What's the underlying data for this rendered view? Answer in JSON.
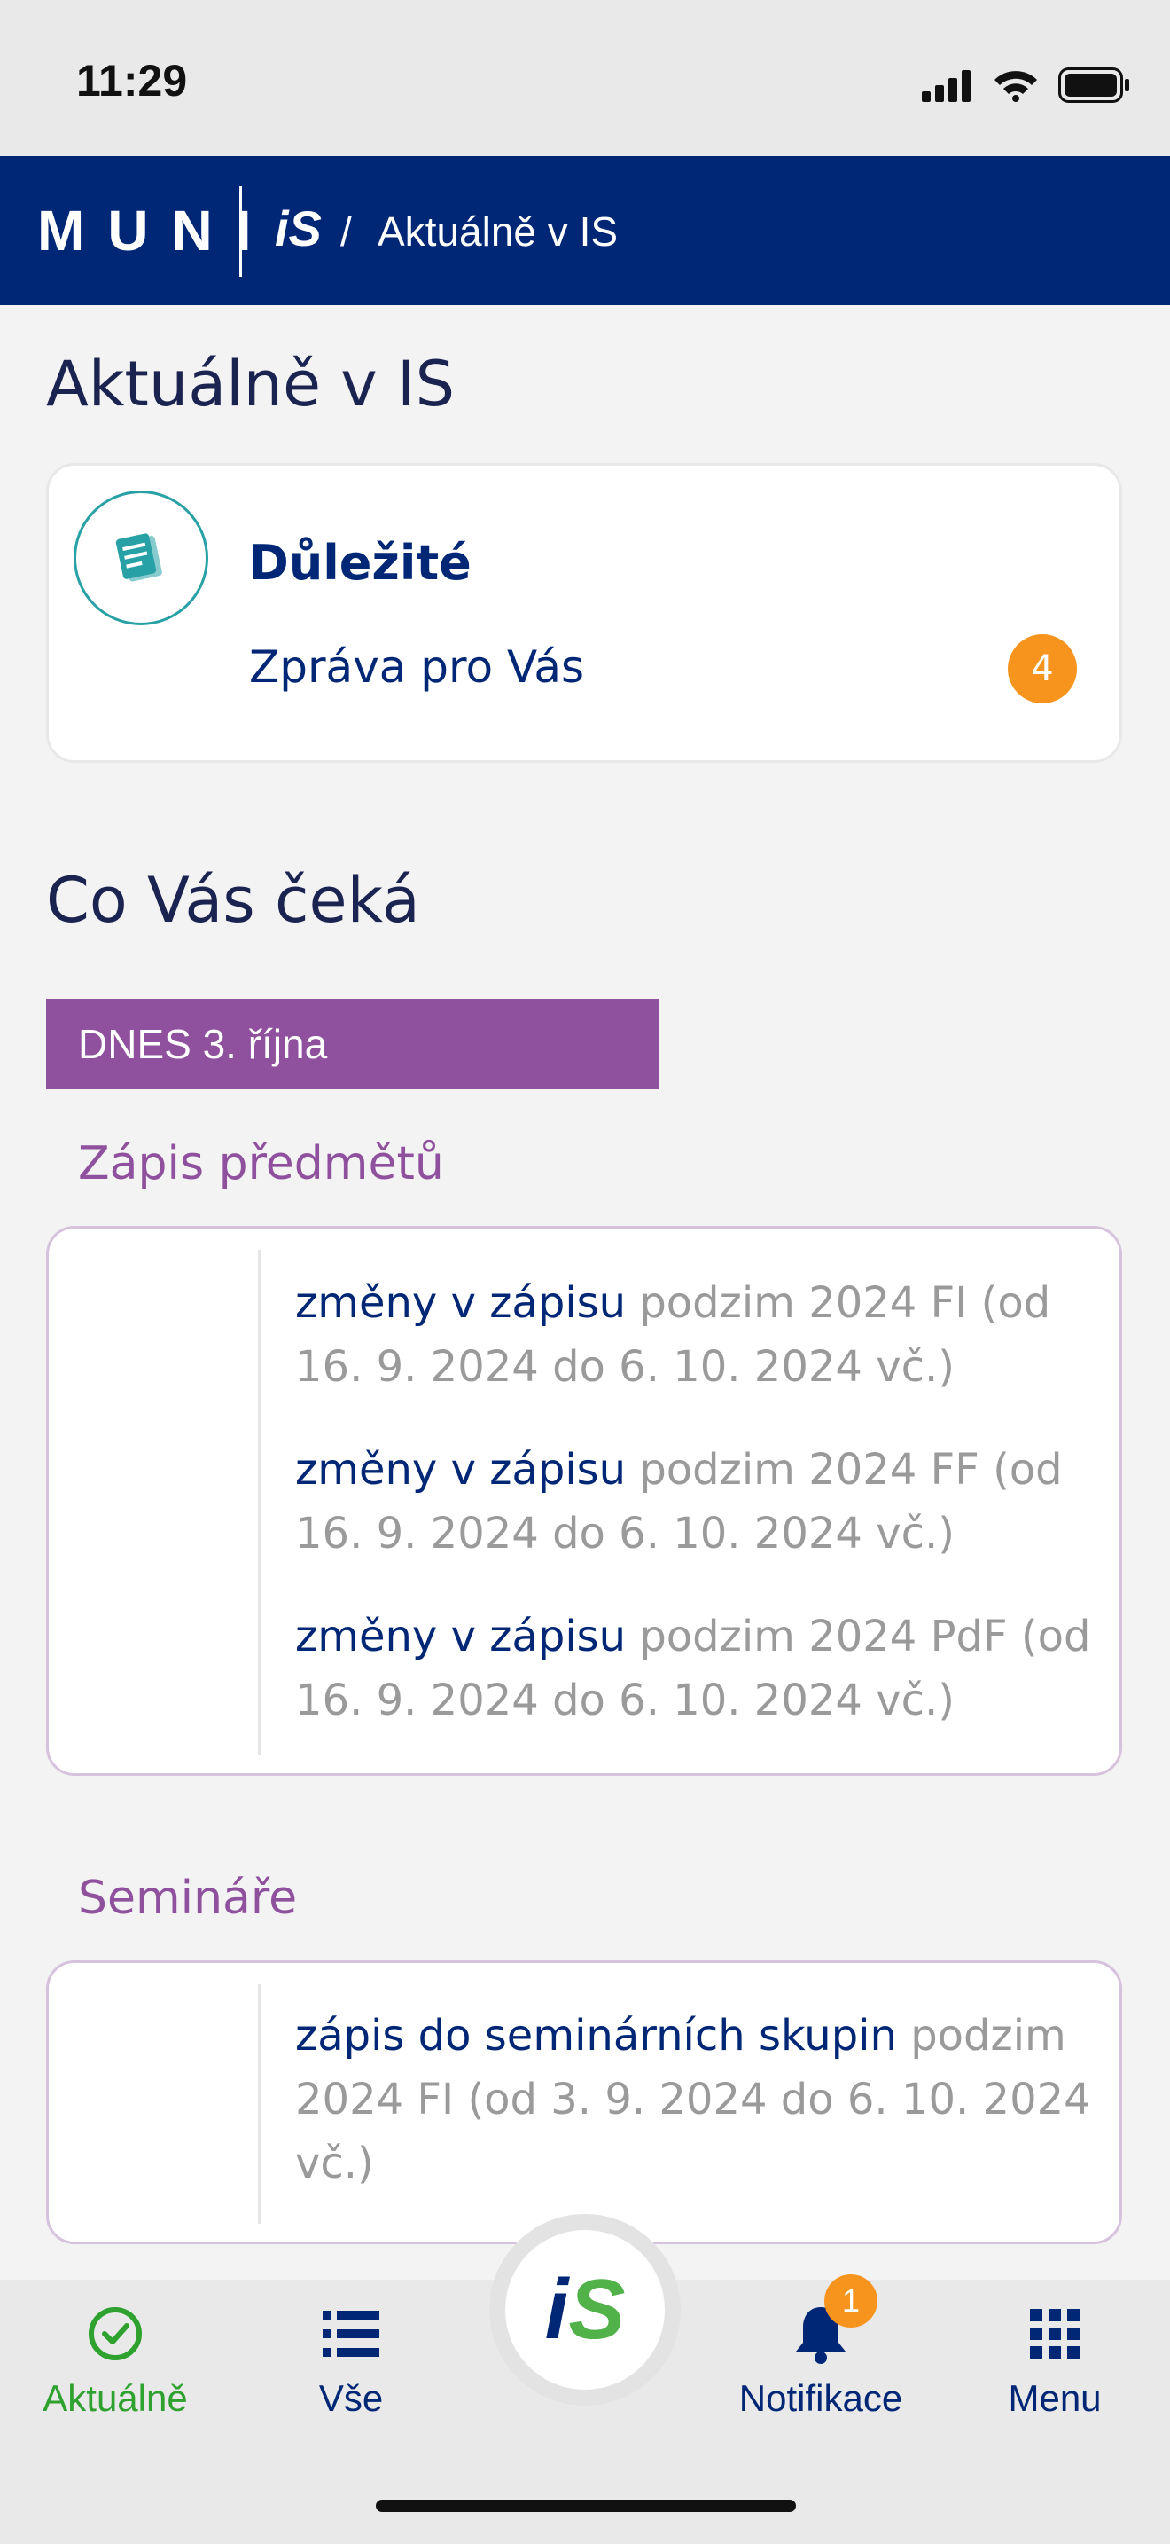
{
  "status_bar": {
    "time": "11:29"
  },
  "header": {
    "brand": "MUNI",
    "logo": "iS",
    "separator": "/",
    "breadcrumb": "Aktuálně v IS"
  },
  "page_title": "Aktuálně v IS",
  "important": {
    "icon": "document-icon",
    "title": "Důležité",
    "subtitle": "Zpráva pro Vás",
    "badge": "4"
  },
  "upcoming": {
    "title": "Co Vás čeká",
    "date_tag": "DNES 3. října",
    "sections": [
      {
        "title": "Zápis předmětů",
        "items": [
          {
            "link": "změny v zápisu",
            "text": " podzim 2024 FI (od 16. 9. 2024 do 6. 10. 2024 vč.)"
          },
          {
            "link": "změny v zápisu",
            "text": " podzim 2024 FF (od 16. 9. 2024 do 6. 10. 2024 vč.)"
          },
          {
            "link": "změny v zápisu",
            "text": " podzim 2024 PdF (od 16. 9. 2024 do 6. 10. 2024 vč.)"
          }
        ]
      },
      {
        "title": "Semináře",
        "items": [
          {
            "link": "zápis do seminárních skupin",
            "text": " podzim 2024 FI (od 3. 9. 2024 do 6. 10. 2024 vč.)"
          }
        ]
      }
    ]
  },
  "bottom_nav": {
    "items": [
      {
        "label": "Aktuálně",
        "icon": "check-circle-icon",
        "active": true
      },
      {
        "label": "Vše",
        "icon": "list-icon"
      },
      {
        "label": "Notifikace",
        "icon": "bell-icon",
        "badge": "1"
      },
      {
        "label": "Menu",
        "icon": "grid-icon"
      }
    ],
    "center_logo": "iS"
  },
  "colors": {
    "primary": "#002776",
    "header_bg": "#002776",
    "purple": "#8f519d",
    "orange_badge": "#f7941d",
    "teal": "#27a1a6",
    "active_green": "#2ea12e",
    "logo_green": "#52b24a"
  }
}
